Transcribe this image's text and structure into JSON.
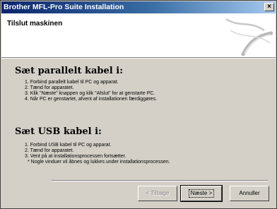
{
  "window": {
    "title": "Brother MFL-Pro Suite Installation",
    "close_glyph": "×"
  },
  "header": {
    "title": "Tilslut maskinen"
  },
  "sections": [
    {
      "heading": "Sæt parallelt kabel i:",
      "steps": [
        "1. Forbind parallelt kabel til PC og apparat.",
        "2. Tænd for apparatet.",
        "3. Klik \"Næste\" knappen og klik \"Afslut\" for at genstarte PC.",
        "4. Når PC er genstartet, afvent af installationen færdiggøres."
      ]
    },
    {
      "heading": "Sæt USB kabel i:",
      "steps": [
        "1. Forbind USB kabel til PC og apparat.",
        "2. Tænd for apparatet.",
        "3. Vent på at installationsprocessen fortsætter.",
        "* Nogle vinduer vil åbnes og lukkes under installationsprocessen."
      ]
    }
  ],
  "buttons": {
    "back": "< Tilbage",
    "next": "Næste >",
    "cancel": "Annuller"
  }
}
